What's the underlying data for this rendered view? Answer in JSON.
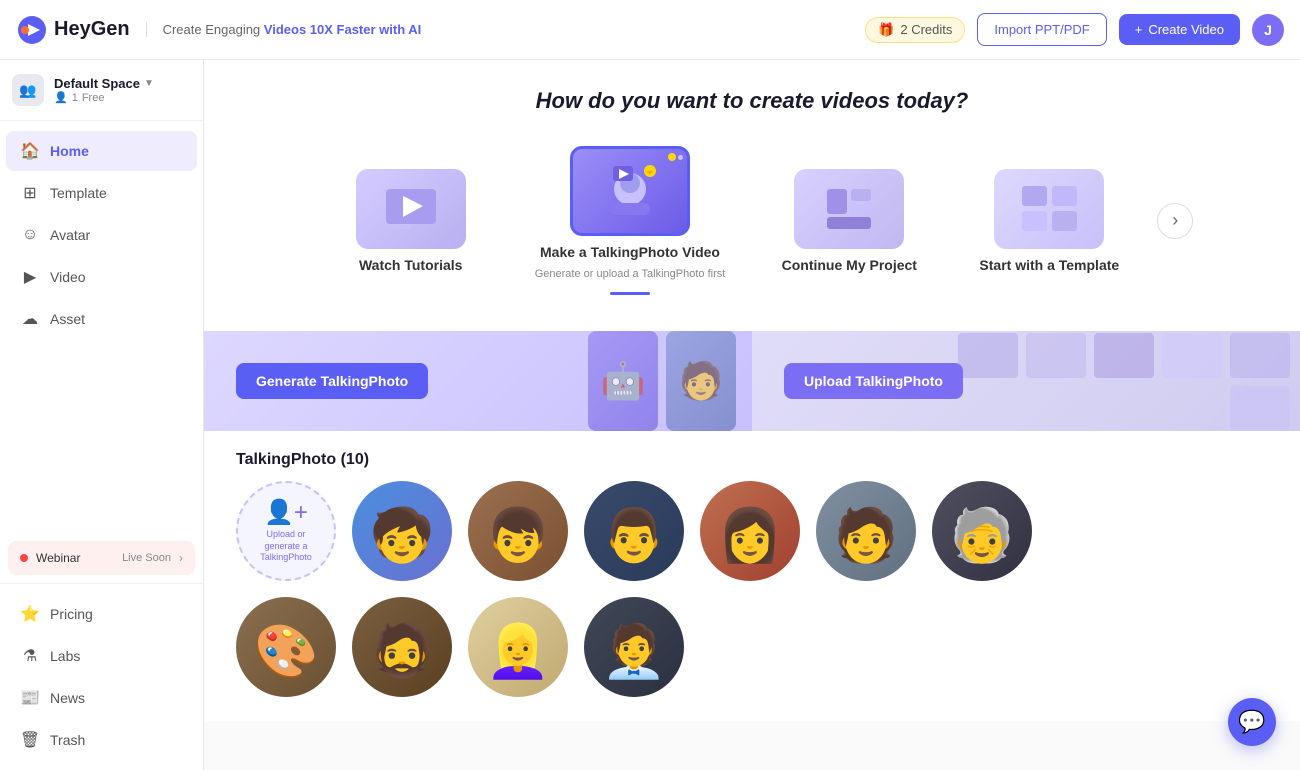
{
  "header": {
    "logo_text": "HeyGen",
    "tagline_prefix": "Create Engaging ",
    "tagline_highlight": "Videos 10X Faster with AI",
    "credits_count": "2 Credits",
    "btn_import": "Import PPT/PDF",
    "btn_create_icon": "+",
    "btn_create": "Create Video",
    "avatar_letter": "J"
  },
  "sidebar": {
    "workspace_name": "Default Space",
    "workspace_users": "1",
    "workspace_plan": "Free",
    "nav_items": [
      {
        "id": "home",
        "label": "Home",
        "icon": "🏠",
        "active": true
      },
      {
        "id": "template",
        "label": "Template",
        "icon": "⊞",
        "active": false
      },
      {
        "id": "avatar",
        "label": "Avatar",
        "icon": "☺",
        "active": false
      },
      {
        "id": "video",
        "label": "Video",
        "icon": "▶",
        "active": false
      },
      {
        "id": "asset",
        "label": "Asset",
        "icon": "☁",
        "active": false
      }
    ],
    "webinar_label": "Webinar",
    "webinar_status": "Live Soon",
    "bottom_nav": [
      {
        "id": "pricing",
        "label": "Pricing",
        "icon": "★"
      },
      {
        "id": "labs",
        "label": "Labs",
        "icon": "⚗"
      },
      {
        "id": "news",
        "label": "News",
        "icon": "⊟"
      },
      {
        "id": "trash",
        "label": "Trash",
        "icon": "🗑"
      }
    ]
  },
  "main": {
    "page_question": "How do you want to create videos today?",
    "cards": [
      {
        "id": "tutorials",
        "label": "Watch Tutorials",
        "sub": "",
        "emoji": "▶",
        "active": false
      },
      {
        "id": "talking-photo",
        "label": "Make a TalkingPhoto Video",
        "sub": "Generate or upload a TalkingPhoto first",
        "emoji": "📸",
        "active": true
      },
      {
        "id": "continue",
        "label": "Continue My Project",
        "sub": "",
        "emoji": "📁",
        "active": false
      },
      {
        "id": "template",
        "label": "Start with a Template",
        "sub": "",
        "emoji": "🎨",
        "active": false
      }
    ],
    "btn_generate": "Generate TalkingPhoto",
    "btn_upload": "Upload TalkingPhoto",
    "section_title": "TalkingPhoto (10)",
    "upload_placeholder_lines": [
      "Upload or",
      "generate a",
      "TalkingPhoto"
    ]
  },
  "chat": {
    "icon": "💬"
  }
}
